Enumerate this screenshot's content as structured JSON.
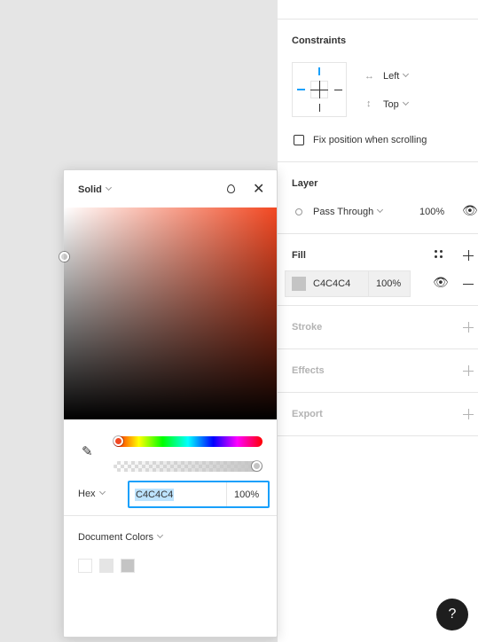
{
  "constraints": {
    "title": "Constraints",
    "horizontal": "Left",
    "vertical": "Top",
    "fix_position_label": "Fix position when scrolling"
  },
  "layer": {
    "title": "Layer",
    "blend_mode": "Pass Through",
    "opacity": "100%"
  },
  "fill": {
    "title": "Fill",
    "hex": "C4C4C4",
    "opacity": "100%",
    "swatch_color": "#c4c4c4"
  },
  "stroke": {
    "title": "Stroke"
  },
  "effects": {
    "title": "Effects"
  },
  "export": {
    "title": "Export"
  },
  "picker": {
    "mode": "Solid",
    "format": "Hex",
    "hex": "C4C4C4",
    "opacity": "100%",
    "hue_color": "#f24822",
    "document_colors_label": "Document Colors",
    "document_colors": [
      "#ffffff",
      "#e5e5e5",
      "#c4c4c4"
    ]
  },
  "help": {
    "label": "?"
  }
}
